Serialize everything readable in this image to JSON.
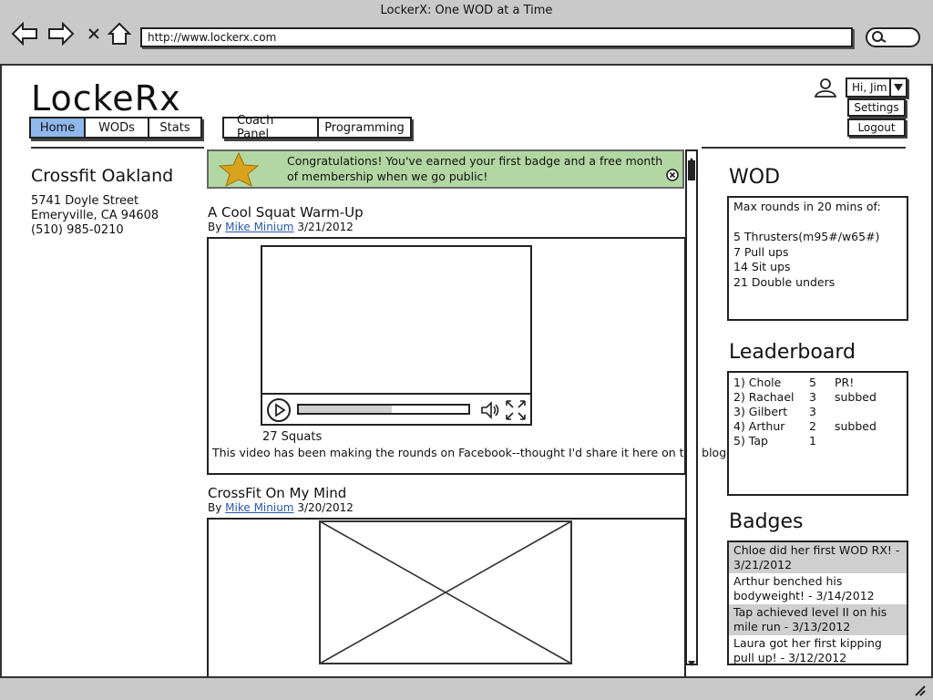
{
  "window": {
    "title": "LockerX: One WOD at a Time",
    "url": "http://www.lockerx.com"
  },
  "site": {
    "logo": "LockeRx",
    "tabs_main": [
      "Home",
      "WODs",
      "Stats"
    ],
    "tabs_admin": [
      "Coach Panel",
      "Programming"
    ],
    "active_tab": "Home"
  },
  "user": {
    "greeting": "Hi, Jim",
    "menu": [
      "Settings",
      "Logout"
    ]
  },
  "gym": {
    "name": "Crossfit Oakland",
    "street": "5741 Doyle Street",
    "city": "Emeryville, CA 94608",
    "phone": "(510) 985-0210"
  },
  "notification": {
    "line1": "Congratulations! You've earned your first badge and a free month",
    "line2": "of membership when we go public!"
  },
  "posts": [
    {
      "title": "A Cool Squat Warm-Up",
      "by": "By",
      "author": "Mike Minium",
      "date": "3/21/2012",
      "caption": "27 Squats",
      "body": "This video has been making the rounds on Facebook--thought I'd share it here on the blog.",
      "video_progress": 0.55
    },
    {
      "title": "CrossFit On My Mind",
      "by": "By",
      "author": "Mike Minium",
      "date": "3/20/2012"
    }
  ],
  "wod": {
    "title": "WOD",
    "lines": [
      "Max rounds in 20 mins of:",
      "",
      "5 Thrusters(m95#/w65#)",
      "7 Pull ups",
      "14 Sit ups",
      "21 Double unders"
    ]
  },
  "leaderboard": {
    "title": "Leaderboard",
    "rows": [
      {
        "name": "1) Chole",
        "score": "5",
        "note": "PR!"
      },
      {
        "name": "2) Rachael",
        "score": "3",
        "note": "subbed"
      },
      {
        "name": "3) Gilbert",
        "score": "3",
        "note": ""
      },
      {
        "name": "4) Arthur",
        "score": "2",
        "note": "subbed"
      },
      {
        "name": "5) Tap",
        "score": "1",
        "note": ""
      }
    ]
  },
  "badges": {
    "title": "Badges",
    "items": [
      {
        "text": "Chloe did her first WOD RX! - 3/21/2012",
        "shaded": true
      },
      {
        "text": "Arthur benched his bodyweight! - 3/14/2012",
        "shaded": false
      },
      {
        "text": "Tap achieved level II on his mile run - 3/13/2012",
        "shaded": true
      },
      {
        "text": "Laura got her first kipping pull up! - 3/12/2012",
        "shaded": false
      }
    ]
  },
  "colors": {
    "active_tab": "#8fb8ec",
    "notification_bg": "#b3d7a3",
    "star": "#d9a21c",
    "link": "#2a59a8"
  }
}
